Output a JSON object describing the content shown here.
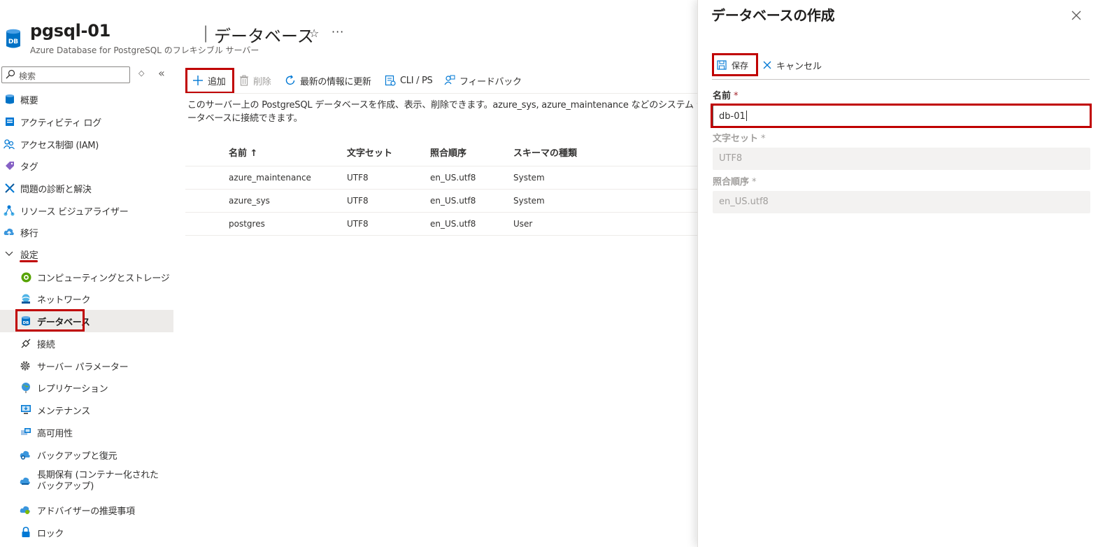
{
  "header": {
    "resource_name": "pgsql-01",
    "separator": "|",
    "page_name": "データベース",
    "subtitle": "Azure Database for PostgreSQL のフレキシブル サーバー",
    "favorite_glyph": "☆",
    "more_glyph": "···",
    "logo_text": "DB"
  },
  "sidebar": {
    "search_placeholder": "検索",
    "items": [
      {
        "label": "概要",
        "icon": "overview-icon"
      },
      {
        "label": "アクティビティ ログ",
        "icon": "activity-log-icon"
      },
      {
        "label": "アクセス制御 (IAM)",
        "icon": "iam-icon"
      },
      {
        "label": "タグ",
        "icon": "tag-icon"
      },
      {
        "label": "問題の診断と解決",
        "icon": "diagnose-icon"
      },
      {
        "label": "リソース ビジュアライザー",
        "icon": "visualizer-icon"
      },
      {
        "label": "移行",
        "icon": "migration-icon"
      }
    ],
    "section": {
      "label": "設定",
      "expanded": true
    },
    "settings_items": [
      {
        "label": "コンピューティングとストレージ",
        "icon": "compute-storage-icon"
      },
      {
        "label": "ネットワーク",
        "icon": "network-icon"
      },
      {
        "label": "データベース",
        "icon": "database-icon",
        "selected": true
      },
      {
        "label": "接続",
        "icon": "connect-icon"
      },
      {
        "label": "サーバー パラメーター",
        "icon": "gear-icon"
      },
      {
        "label": "レプリケーション",
        "icon": "replication-icon"
      },
      {
        "label": "メンテナンス",
        "icon": "maintenance-icon"
      },
      {
        "label": "高可用性",
        "icon": "high-availability-icon"
      },
      {
        "label": "バックアップと復元",
        "icon": "backup-icon"
      },
      {
        "label": "長期保有 (コンテナー化された\nバックアップ)",
        "icon": "long-term-backup-icon"
      },
      {
        "label": "アドバイザーの推奨事項",
        "icon": "advisor-icon"
      },
      {
        "label": "ロック",
        "icon": "lock-icon"
      }
    ]
  },
  "toolbar": {
    "add_label": "追加",
    "delete_label": "削除",
    "refresh_label": "最新の情報に更新",
    "cli_label": "CLI / PS",
    "feedback_label": "フィードバック"
  },
  "description": {
    "line1": "このサーバー上の PostgreSQL データベースを作成、表示、削除できます。azure_sys, azure_maintenance などのシステム デー",
    "line2": "ータベースに接続できます。"
  },
  "table": {
    "headers": [
      "名前 ↑",
      "文字セット",
      "照合順序",
      "スキーマの種類"
    ],
    "rows": [
      [
        "azure_maintenance",
        "UTF8",
        "en_US.utf8",
        "System"
      ],
      [
        "azure_sys",
        "UTF8",
        "en_US.utf8",
        "System"
      ],
      [
        "postgres",
        "UTF8",
        "en_US.utf8",
        "User"
      ]
    ]
  },
  "panel": {
    "title": "データベースの作成",
    "save_label": "保存",
    "cancel_label": "キャンセル",
    "name_label": "名前",
    "name_value": "db-01",
    "charset_label": "文字セット",
    "charset_value": "UTF8",
    "collation_label": "照合順序",
    "collation_value": "en_US.utf8",
    "required_mark": "*"
  },
  "colors": {
    "accent": "#0078d4",
    "highlight": "#c00000",
    "selected_bg": "#edebe9"
  }
}
